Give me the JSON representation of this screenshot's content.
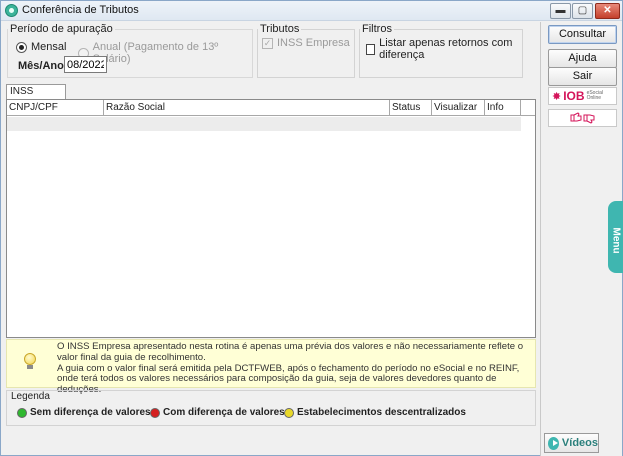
{
  "window": {
    "title": "Conferência de Tributos",
    "controls": {
      "minimize": "▬",
      "maximize": "▢",
      "close": "✕"
    }
  },
  "periodo": {
    "legend": "Período de apuração",
    "mensal_label": "Mensal",
    "anual_label": "Anual (Pagamento de 13º Salário)",
    "selected": "mensal",
    "mesano_label": "Mês/Ano",
    "mesano_value": "08/2022"
  },
  "tributos": {
    "legend": "Tributos",
    "inss_label": "INSS Empresa",
    "inss_checked": true
  },
  "filtros": {
    "legend": "Filtros",
    "listar_label": "Listar apenas retornos com diferença",
    "listar_checked": false
  },
  "side": {
    "consultar": "Consultar",
    "ajuda": "Ajuda",
    "sair": "Sair",
    "iob_brand": "IOB",
    "iob_sub": "eSocial Online",
    "menu": "Menu",
    "videos": "Vídeos"
  },
  "tab": {
    "label": "INSS Empresa"
  },
  "grid": {
    "columns": [
      "CNPJ/CPF",
      "Razão Social",
      "Status",
      "Visualizar XML",
      "Info"
    ]
  },
  "info": {
    "line1": "O INSS Empresa apresentado nesta rotina é apenas uma prévia dos valores e não necessariamente reflete o valor final da guia de recolhimento.",
    "line2": "A guia com o valor final será emitida pela DCTFWEB, após o fechamento do período no eSocial e no REINF, onde terá todos os valores necessários para composição da guia, seja de valores devedores quanto de deduções."
  },
  "legend": {
    "title": "Legenda",
    "items": [
      {
        "label": "Sem diferença de valores",
        "color": "#2fb82f"
      },
      {
        "label": "Com diferença de valores",
        "color": "#d42020"
      },
      {
        "label": "Estabelecimentos descentralizados",
        "color": "#e8d82a"
      }
    ]
  }
}
